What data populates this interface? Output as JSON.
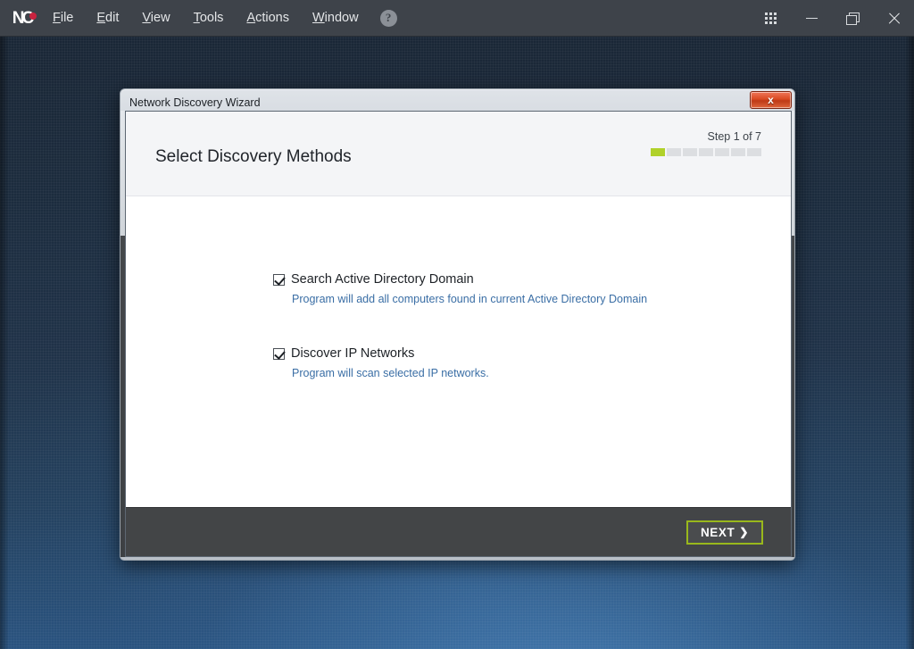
{
  "app": {
    "logo": {
      "letter_n": "N",
      "letter_c": "C",
      "dot_color": "#c9233f",
      "icon_name": "nc-app-logo"
    },
    "menu": [
      {
        "label": "File",
        "accel": "F"
      },
      {
        "label": "Edit",
        "accel": "E"
      },
      {
        "label": "View",
        "accel": "V"
      },
      {
        "label": "Tools",
        "accel": "T"
      },
      {
        "label": "Actions",
        "accel": "A"
      },
      {
        "label": "Window",
        "accel": "W"
      }
    ],
    "help_button": "?",
    "window_controls": {
      "apps_grid": "apps-grid-icon",
      "minimize": "minimize-icon",
      "restore": "restore-icon",
      "close": "close-icon"
    },
    "titlebar_bg": "#3e434a"
  },
  "dialog": {
    "title": "Network Discovery Wizard",
    "close_label": "x",
    "header": {
      "title": "Select Discovery Methods",
      "step_label": "Step 1 of 7",
      "step_total": 7,
      "step_current": 1,
      "accent_color": "#b0d12a"
    },
    "options": [
      {
        "label": "Search Active Directory Domain",
        "description": "Program will add all computers found in current Active Directory Domain",
        "checked": true
      },
      {
        "label": "Discover IP Networks",
        "description": "Program will scan selected IP networks.",
        "checked": true
      }
    ],
    "footer": {
      "next_label": "NEXT",
      "next_chevron": "❯",
      "next_border_color": "#99b81c"
    }
  }
}
